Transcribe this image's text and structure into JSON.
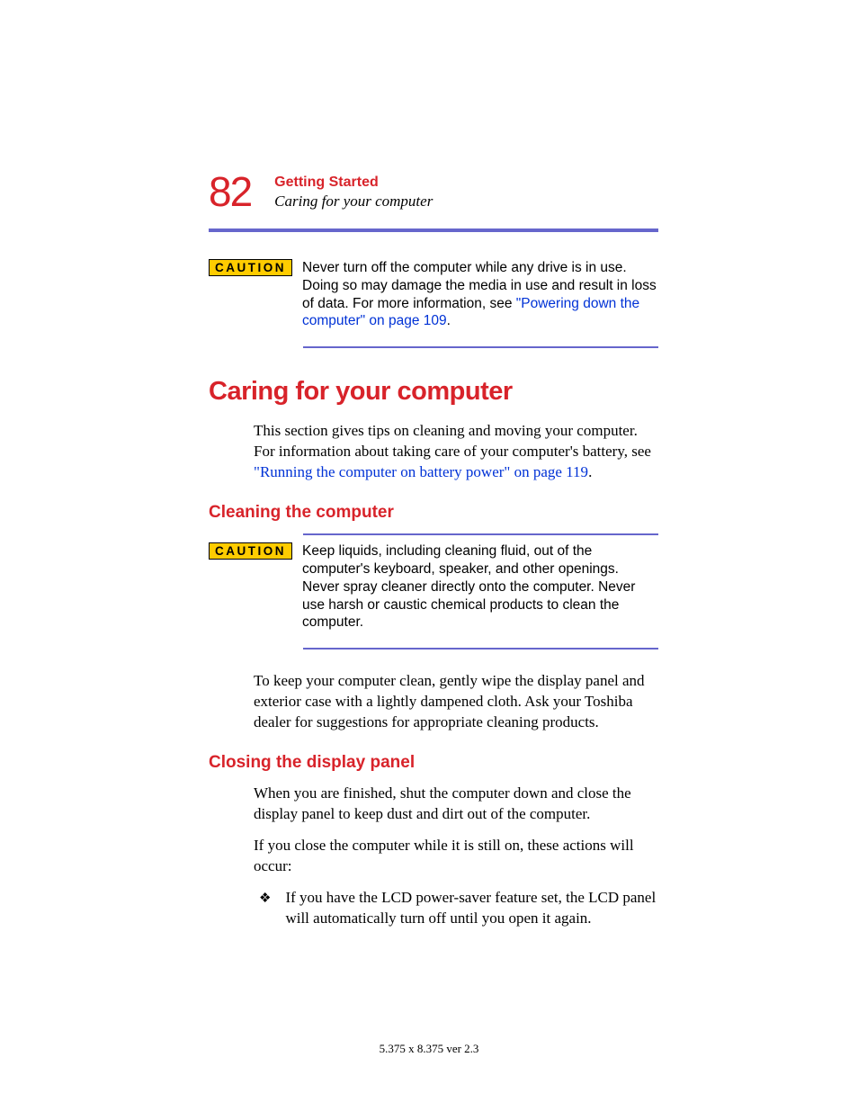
{
  "header": {
    "page_number": "82",
    "chapter": "Getting Started",
    "section": "Caring for your computer"
  },
  "caution1": {
    "label": "CAUTION",
    "text_before_link": "Never turn off the computer while any drive is in use. Doing so may damage the media in use and result in loss of data. For more information, see ",
    "link": "\"Powering down the computer\" on page 109",
    "text_after_link": "."
  },
  "heading1": "Caring for your computer",
  "intro": {
    "text_before_link": "This section gives tips on cleaning and moving your computer. For information about taking care of your computer's battery, see ",
    "link": "\"Running the computer on battery power\" on page 119",
    "text_after_link": "."
  },
  "heading2a": "Cleaning the computer",
  "caution2": {
    "label": "CAUTION",
    "text": "Keep liquids, including cleaning fluid, out of the computer's keyboard, speaker, and other openings. Never spray cleaner directly onto the computer. Never use harsh or caustic chemical products to clean the computer."
  },
  "cleaning_para": "To keep your computer clean, gently wipe the display panel and exterior case with a lightly dampened cloth. Ask your Toshiba dealer for suggestions for appropriate cleaning products.",
  "heading2b": "Closing the display panel",
  "closing_para1": "When you are finished, shut the computer down and close the display panel to keep dust and dirt out of the computer.",
  "closing_para2": "If you close the computer while it is still on, these actions will occur:",
  "bullet1": "If you have the LCD power-saver feature set, the LCD panel will automatically turn off until you open it again.",
  "footer": "5.375 x 8.375 ver 2.3"
}
